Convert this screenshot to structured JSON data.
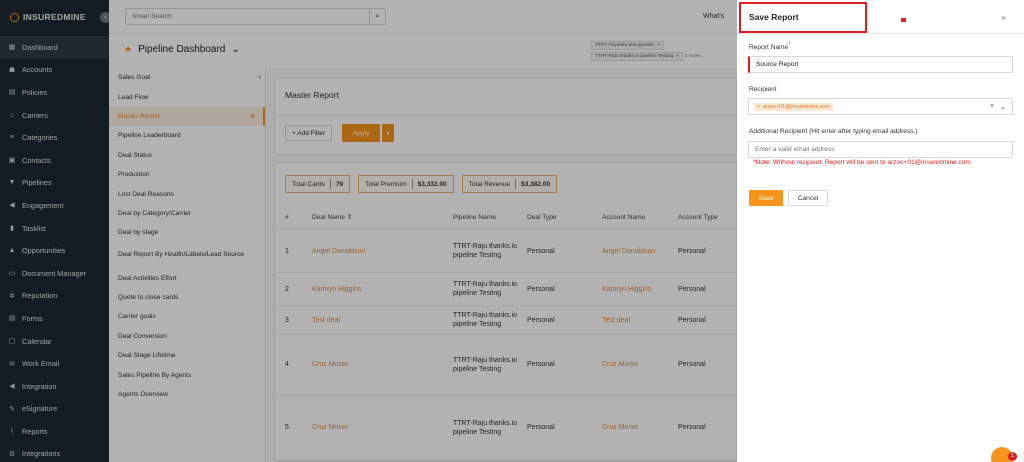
{
  "app": {
    "logo_text": "INSUREDMINE",
    "collapse_icon": "‹"
  },
  "sidebar": {
    "items": [
      {
        "label": "Dashboard",
        "icon": "▦",
        "icon_name": "dashboard-icon"
      },
      {
        "label": "Accounts",
        "icon": "☗",
        "icon_name": "accounts-icon"
      },
      {
        "label": "Policies",
        "icon": "▤",
        "icon_name": "policies-icon"
      },
      {
        "label": "Carriers",
        "icon": "⌂",
        "icon_name": "carriers-icon"
      },
      {
        "label": "Categories",
        "icon": "≡",
        "icon_name": "categories-icon"
      },
      {
        "label": "Contacts",
        "icon": "▣",
        "icon_name": "contacts-icon"
      },
      {
        "label": "Pipelines",
        "icon": "▼",
        "icon_name": "pipelines-icon"
      },
      {
        "label": "Engagement",
        "icon": "◀",
        "icon_name": "engagement-icon"
      },
      {
        "label": "Tasklist",
        "icon": "▮",
        "icon_name": "tasklist-icon"
      },
      {
        "label": "Opportunities",
        "icon": "▲",
        "icon_name": "opportunities-icon"
      },
      {
        "label": "Document Manager",
        "icon": "▭",
        "icon_name": "folder-icon"
      },
      {
        "label": "Reputation",
        "icon": "✲",
        "icon_name": "reputation-icon"
      },
      {
        "label": "Forms",
        "icon": "▤",
        "icon_name": "forms-icon"
      },
      {
        "label": "Calendar",
        "icon": "▢",
        "icon_name": "calendar-icon"
      },
      {
        "label": "Work Email",
        "icon": "✉",
        "icon_name": "email-icon"
      },
      {
        "label": "Integration",
        "icon": "◀",
        "icon_name": "integration-icon"
      },
      {
        "label": "eSignature",
        "icon": "✎",
        "icon_name": "esignature-icon"
      },
      {
        "label": "Reports",
        "icon": "⌇",
        "icon_name": "reports-icon"
      },
      {
        "label": "Integrations",
        "icon": "⚙",
        "icon_name": "integrations-icon"
      }
    ]
  },
  "topbar": {
    "search_placeholder": "Smart Search",
    "search_icon": "⌕",
    "whats_new": "What's"
  },
  "dashboard": {
    "star": "★",
    "title": "Pipeline Dashboard",
    "chevron": "⌄",
    "chips": [
      {
        "label": "TTRT-Priyanka test pipeline"
      },
      {
        "label": "TTRT-Raju thanks.io pipeline Testing"
      }
    ],
    "more": "1 more..."
  },
  "report_list": {
    "collapse": "‹",
    "items": [
      {
        "label": "Sales Goal"
      },
      {
        "label": "Lead Flow"
      },
      {
        "label": "Master Report",
        "active": true,
        "badge": "⚙"
      },
      {
        "label": "Pipeline Leaderboard"
      },
      {
        "label": "Deal Status"
      },
      {
        "label": "Production"
      },
      {
        "label": "Lost Deal Reasons"
      },
      {
        "label": "Deal by Category/Carrier"
      },
      {
        "label": "Deal by stage"
      },
      {
        "label": "Deal Report By Health/Labels/Lead Source",
        "two_line": true
      },
      {
        "label": "Deal Activities Effort"
      },
      {
        "label": "Quote to close cards"
      },
      {
        "label": "Carrier goals"
      },
      {
        "label": "Deal Conversion"
      },
      {
        "label": "Deal Stage Lifetime"
      },
      {
        "label": "Sales Pipeline By Agents"
      },
      {
        "label": "Agents Overview"
      }
    ]
  },
  "report": {
    "title": "Master Report",
    "add_filter": "+ Add Filter",
    "apply": "Apply",
    "apply_dropdown": "▾",
    "summary": [
      {
        "label": "Total Cards",
        "value": "79"
      },
      {
        "label": "Total Premium",
        "value": "$3,332.00"
      },
      {
        "label": "Total Revenue",
        "value": "$3,382.00"
      }
    ],
    "columns": [
      "#",
      "Deal Name ⇕",
      "Pipeline Name",
      "Deal Type",
      "Account Name",
      "Account Type"
    ],
    "rows": [
      {
        "num": "1",
        "deal": "Angel Donaldson",
        "pipeline": "TTRT-Raju thanks.io pipeline Testing",
        "type": "Personal",
        "account": "Angel Donaldson",
        "account_type": "Personal"
      },
      {
        "num": "2",
        "deal": "Kamryn Higgins",
        "pipeline": "TTRT-Raju thanks.io pipeline Testing",
        "type": "Personal",
        "account": "Kamryn Higgins",
        "account_type": "Personal"
      },
      {
        "num": "3",
        "deal": "Test deal",
        "pipeline": "TTRT-Raju thanks.io pipeline Testing",
        "type": "Personal",
        "account": "Test deal",
        "account_type": "Personal"
      },
      {
        "num": "4",
        "deal": "Cruz Morse",
        "pipeline": "TTRT-Raju thanks.io pipeline Testing",
        "type": "Personal",
        "account": "Cruz Morse",
        "account_type": "Personal"
      },
      {
        "num": "5",
        "deal": "Cruz Morse",
        "pipeline": "TTRT-Raju thanks.io pipeline Testing",
        "type": "Personal",
        "account": "Cruz Morse",
        "account_type": "Personal"
      }
    ]
  },
  "save_panel": {
    "title": "Save Report",
    "close": "×",
    "report_name_label": "Report Name",
    "required_mark": "*",
    "report_name_value": "Source Report",
    "recipient_label": "Recipient",
    "recipient_tag": "arzoo+01@insuredmine.com",
    "tag_remove": "×",
    "clear_icon": "×",
    "dropdown_icon": "⌄",
    "additional_label": "Additional Recipient (Hit enter after typing email address.)",
    "additional_placeholder": "Enter a valid email address",
    "note": "*Note: Without recipient, Report will be sent to arzoo+01@insuredmine.com",
    "save": "Save",
    "cancel": "Cancel"
  },
  "chat": {
    "badge": "1"
  },
  "colors": {
    "accent": "#f7941d",
    "sidebar_bg": "#1e2a33",
    "error": "#e02020"
  }
}
